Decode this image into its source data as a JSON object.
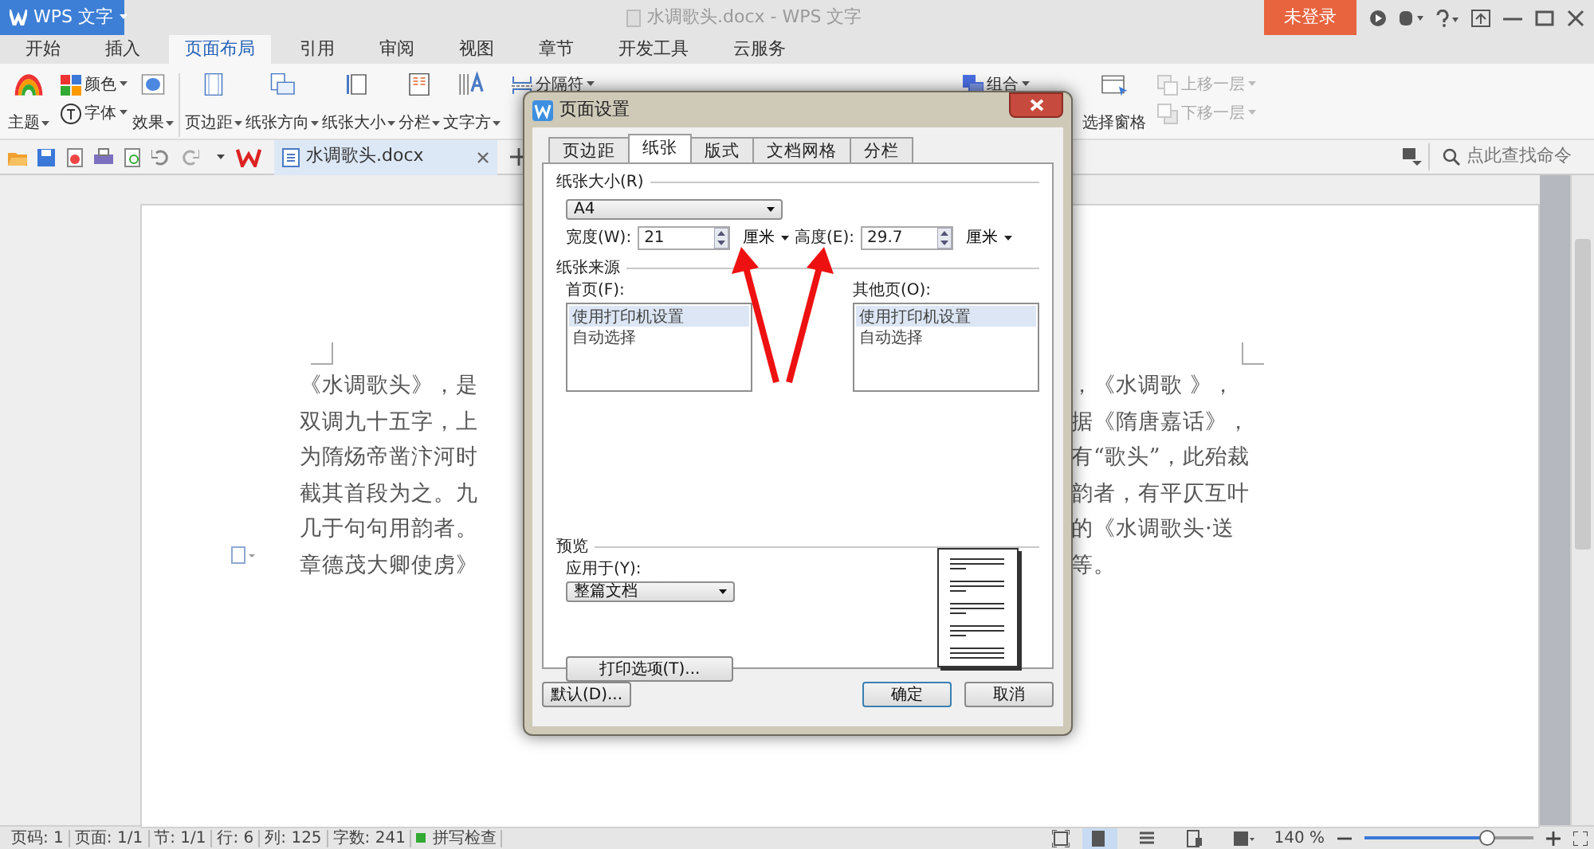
{
  "app_menu": {
    "label": "WPS 文字"
  },
  "window": {
    "title": "水调歌头.docx - WPS 文字"
  },
  "login_button": {
    "label": "未登录"
  },
  "ribbon_tabs": [
    {
      "label": "开始",
      "selected": false
    },
    {
      "label": "插入",
      "selected": false
    },
    {
      "label": "页面布局",
      "selected": true
    },
    {
      "label": "引用",
      "selected": false
    },
    {
      "label": "审阅",
      "selected": false
    },
    {
      "label": "视图",
      "selected": false
    },
    {
      "label": "章节",
      "selected": false
    },
    {
      "label": "开发工具",
      "selected": false
    },
    {
      "label": "云服务",
      "selected": false
    }
  ],
  "ribbon_left": [
    {
      "kind": "large",
      "label": "主题"
    },
    {
      "kind": "stack",
      "items": [
        {
          "label": "颜色",
          "disabled": false
        },
        {
          "label": "字体",
          "disabled": false
        }
      ]
    },
    {
      "kind": "large",
      "label": "效果"
    },
    {
      "kind": "separator"
    },
    {
      "kind": "large",
      "label": "页边距"
    },
    {
      "kind": "large",
      "label": "纸张方向"
    },
    {
      "kind": "large",
      "label": "纸张大小"
    },
    {
      "kind": "large",
      "label": "分栏"
    },
    {
      "kind": "large",
      "label": "文字方"
    },
    {
      "kind": "stack",
      "items": [
        {
          "label": "分隔符",
          "disabled": false
        }
      ]
    }
  ],
  "ribbon_right": [
    {
      "kind": "stack",
      "items": [
        {
          "label": "组合",
          "disabled": false
        }
      ]
    },
    {
      "kind": "large",
      "label": "选择窗格"
    },
    {
      "kind": "stack",
      "items": [
        {
          "label": "上移一层",
          "disabled": true
        },
        {
          "label": "下移一层",
          "disabled": true
        }
      ]
    }
  ],
  "document_tabs": [
    {
      "label": "水调歌头.docx",
      "selected": true
    }
  ],
  "command_search": {
    "placeholder": "点此查找命令"
  },
  "document_lines": [
    {
      "left": "《水调歌头》，是",
      "right": "，《水调歌 》，"
    },
    {
      "left": "双调九十五字，上",
      "right": "据《隋唐嘉话》，"
    },
    {
      "left": "为隋炀帝凿汴河时",
      "right": "有“歌头”，此殆裁"
    },
    {
      "left": "截其首段为之。九",
      "right": "韵者，有平仄互叶"
    },
    {
      "left": "几于句句用韵者。",
      "right": "的《水调歌头·送"
    },
    {
      "left": "章德茂大卿使虏》",
      "right": "等。"
    }
  ],
  "dialog": {
    "title": "页面设置",
    "tabs": [
      {
        "label": "页边距",
        "selected": false
      },
      {
        "label": "纸张",
        "selected": true
      },
      {
        "label": "版式",
        "selected": false
      },
      {
        "label": "文档网格",
        "selected": false
      },
      {
        "label": "分栏",
        "selected": false
      }
    ],
    "paper_size": {
      "legend": "纸张大小(R)",
      "value": "A4",
      "width_label": "宽度(W):",
      "width_value": "21",
      "width_unit": "厘米",
      "height_label": "高度(E):",
      "height_value": "29.7",
      "height_unit": "厘米"
    },
    "paper_source": {
      "legend": "纸张来源",
      "lists": [
        {
          "label": "首页(F):",
          "options": [
            {
              "label": "使用打印机设置",
              "selected": true
            },
            {
              "label": "自动选择",
              "selected": false
            }
          ]
        },
        {
          "label": "其他页(O):",
          "options": [
            {
              "label": "使用打印机设置",
              "selected": true
            },
            {
              "label": "自动选择",
              "selected": false
            }
          ]
        }
      ]
    },
    "preview": {
      "legend": "预览",
      "apply_label": "应用于(Y):",
      "apply_value": "整篇文档"
    },
    "print_options_button": "打印选项(T)...",
    "default_button": "默认(D)...",
    "ok_button": "确定",
    "cancel_button": "取消"
  },
  "status_bar": {
    "items": [
      "页码: 1",
      "页面: 1/1",
      "节: 1/1",
      "行: 6",
      "列: 125",
      "字数: 241"
    ],
    "spell_check": "拼写检查",
    "view_modes": [
      {
        "selected": false
      },
      {
        "selected": true
      },
      {
        "selected": false
      },
      {
        "selected": false
      },
      {
        "selected": false
      }
    ],
    "zoom": "140 %",
    "zoom_level": {
      "level": 0.73
    }
  }
}
